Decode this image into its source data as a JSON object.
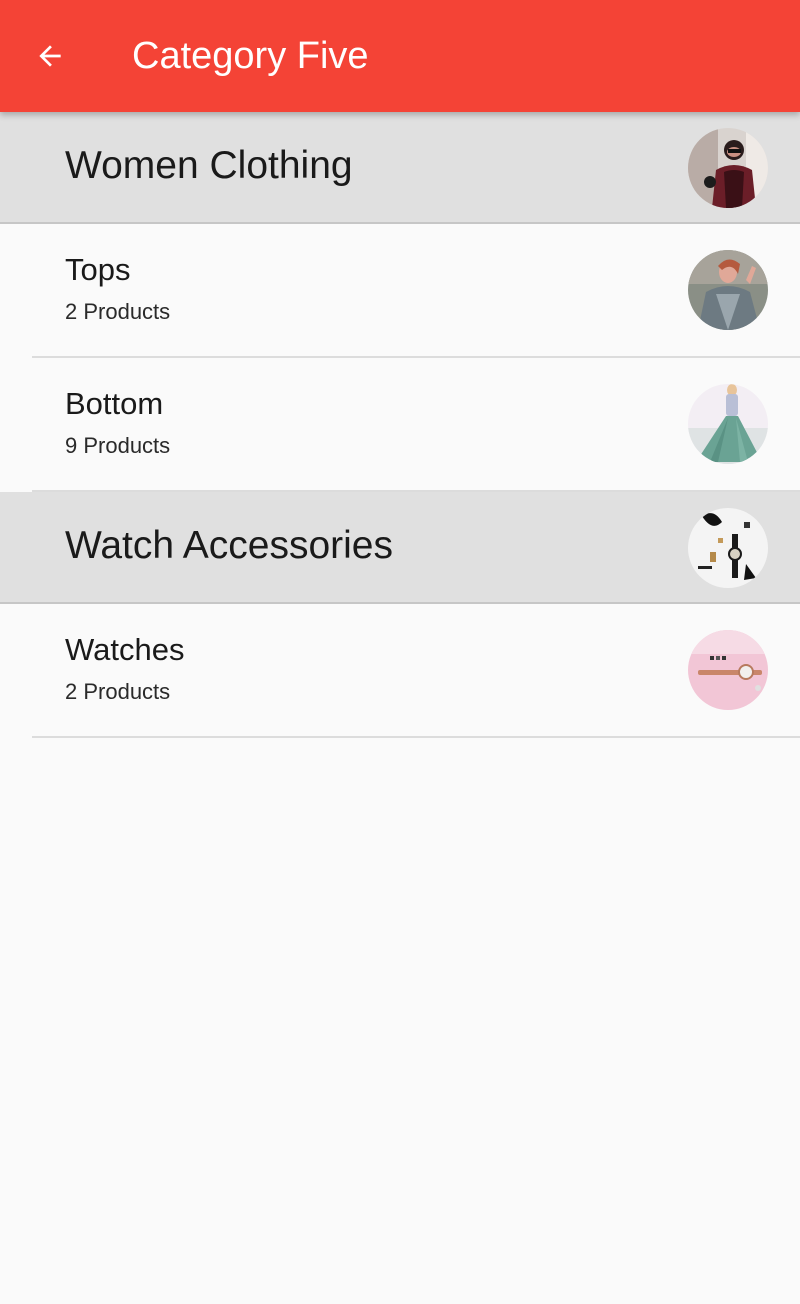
{
  "appbar": {
    "title": "Category Five",
    "back_icon": "arrow-back-icon",
    "color": "#f44336"
  },
  "groups": [
    {
      "title": "Women Clothing",
      "image": "women-clothing-photo",
      "items": [
        {
          "name": "Tops",
          "count": "2 Products",
          "image": "tops-photo"
        },
        {
          "name": "Bottom",
          "count": "9 Products",
          "image": "bottom-photo"
        }
      ]
    },
    {
      "title": "Watch Accessories",
      "image": "watch-accessories-photo",
      "items": [
        {
          "name": "Watches",
          "count": "2 Products",
          "image": "watches-photo"
        }
      ]
    }
  ]
}
